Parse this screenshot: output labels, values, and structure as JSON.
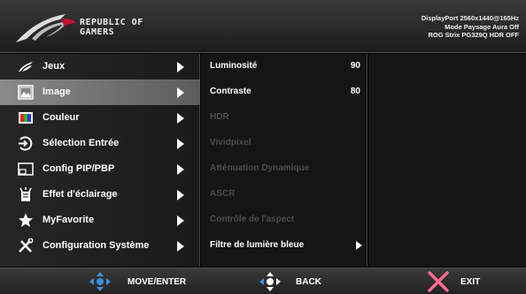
{
  "header": {
    "brand_line1": "REPUBLIC OF",
    "brand_line2": "GAMERS",
    "info_line1": "DisplayPort 2560x1440@165Hz",
    "info_line2": "Mode Paysage Aura Off",
    "info_line3": "ROG Strix PG329Q HDR OFF"
  },
  "sidebar": {
    "items": [
      {
        "label": "Jeux",
        "icon": "rog-eye-icon",
        "active": false
      },
      {
        "label": "Image",
        "icon": "image-icon",
        "active": true
      },
      {
        "label": "Couleur",
        "icon": "color-icon",
        "active": false
      },
      {
        "label": "Sélection Entrée",
        "icon": "input-select-icon",
        "active": false
      },
      {
        "label": "Config PIP/PBP",
        "icon": "pip-icon",
        "active": false
      },
      {
        "label": "Effet d'éclairage",
        "icon": "lighting-icon",
        "active": false
      },
      {
        "label": "MyFavorite",
        "icon": "star-icon",
        "active": false
      },
      {
        "label": "Configuration Système",
        "icon": "tools-icon",
        "active": false
      }
    ]
  },
  "submenu": {
    "items": [
      {
        "label": "Luminosité",
        "value": "90",
        "enabled": true
      },
      {
        "label": "Contraste",
        "value": "80",
        "enabled": true
      },
      {
        "label": "HDR",
        "enabled": false
      },
      {
        "label": "Vividpixel",
        "enabled": false
      },
      {
        "label": "Atténuation Dynamique",
        "enabled": false
      },
      {
        "label": "ASCR",
        "enabled": false
      },
      {
        "label": "Contrôle de l'aspect",
        "enabled": false
      },
      {
        "label": "Filtre de lumière bleue",
        "enabled": true,
        "has_arrow": true
      }
    ]
  },
  "footer": {
    "move_label": "MOVE/ENTER",
    "back_label": "BACK",
    "exit_label": "EXIT"
  },
  "colors": {
    "accent_blue": "#3a8fe0",
    "exit_pink": "#ff6b8a",
    "rog_red": "#c4122f"
  }
}
